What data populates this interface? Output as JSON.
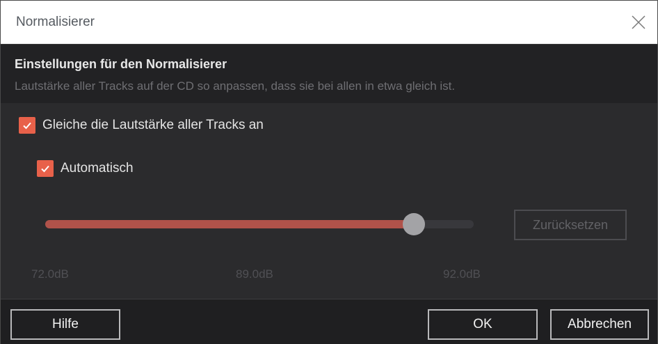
{
  "window": {
    "title": "Normalisierer",
    "close_icon": "close-icon"
  },
  "header": {
    "heading": "Einstellungen für den Normalisierer",
    "subheading": "Lautstärke aller Tracks auf der CD so anpassen, dass sie bei allen in etwa gleich ist."
  },
  "options": {
    "equalize": {
      "label": "Gleiche die Lautstärke aller Tracks an",
      "checked": true
    },
    "automatic": {
      "label": "Automatisch",
      "checked": true
    }
  },
  "slider": {
    "min_label": "72.0dB",
    "mid_label": "89.0dB",
    "max_label": "92.0dB",
    "fill_fraction": 0.86,
    "reset_label": "Zurücksetzen"
  },
  "footer": {
    "help_label": "Hilfe",
    "ok_label": "OK",
    "cancel_label": "Abbrechen"
  },
  "colors": {
    "accent": "#e8614a",
    "slider_fill": "#b0524a",
    "thumb": "#a3a3a6"
  }
}
